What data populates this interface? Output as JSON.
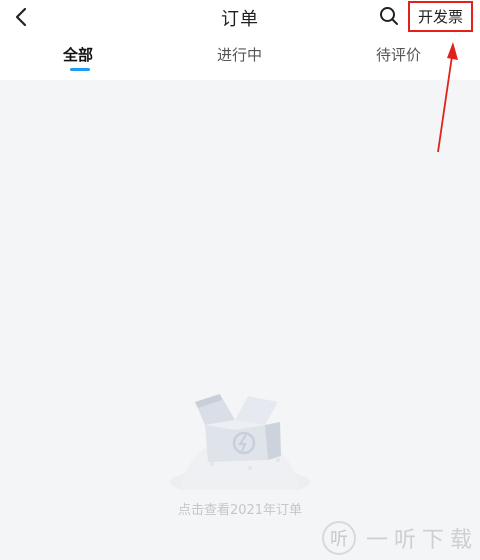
{
  "header": {
    "title": "订单",
    "invoice_label": "开发票",
    "back_icon": "chevron-left-icon",
    "search_icon": "search-icon"
  },
  "tabs": [
    {
      "label": "全部",
      "active": true
    },
    {
      "label": "进行中",
      "active": false
    },
    {
      "label": "待评价",
      "active": false
    }
  ],
  "empty_state": {
    "message": "点击查看2021年订单",
    "icon": "empty-box-icon"
  },
  "watermark": {
    "logo_text": "听",
    "text": "一听下载"
  },
  "colors": {
    "accent": "#1f9bf0",
    "annotation": "#e2211c",
    "background": "#f4f5f7"
  }
}
